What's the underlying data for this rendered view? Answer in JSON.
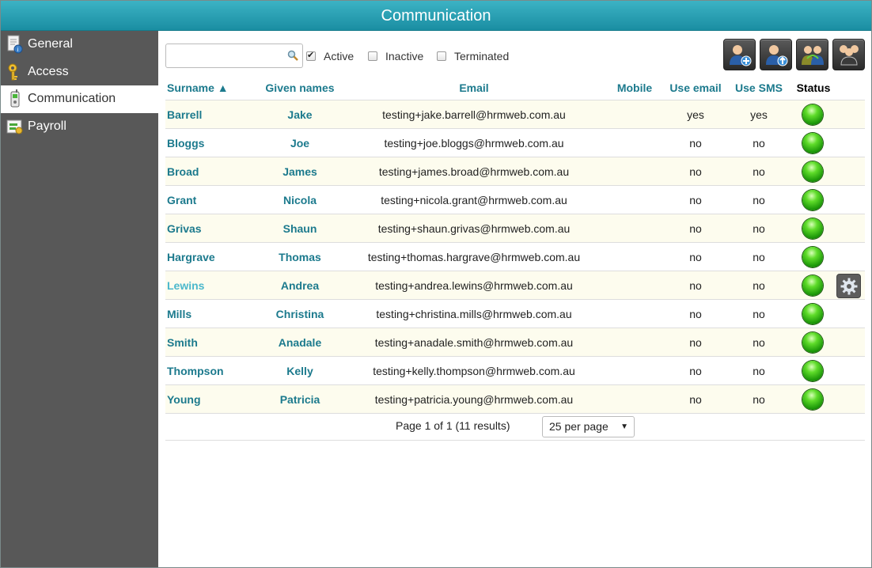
{
  "window": {
    "title": "Communication"
  },
  "sidebar": {
    "items": [
      {
        "label": "General",
        "active": false
      },
      {
        "label": "Access",
        "active": false
      },
      {
        "label": "Communication",
        "active": true
      },
      {
        "label": "Payroll",
        "active": false
      }
    ]
  },
  "search": {
    "value": "",
    "placeholder": ""
  },
  "filters": [
    {
      "label": "Active",
      "checked": true
    },
    {
      "label": "Inactive",
      "checked": false
    },
    {
      "label": "Terminated",
      "checked": false
    }
  ],
  "columns": {
    "surname": "Surname ▲",
    "given": "Given names",
    "email": "Email",
    "mobile": "Mobile",
    "use_email": "Use email",
    "use_sms": "Use SMS",
    "status": "Status"
  },
  "rows": [
    {
      "surname": "Barrell",
      "given": "Jake",
      "email": "testing+jake.barrell@hrmweb.com.au",
      "mobile": "",
      "use_email": "yes",
      "use_sms": "yes"
    },
    {
      "surname": "Bloggs",
      "given": "Joe",
      "email": "testing+joe.bloggs@hrmweb.com.au",
      "mobile": "",
      "use_email": "no",
      "use_sms": "no"
    },
    {
      "surname": "Broad",
      "given": "James",
      "email": "testing+james.broad@hrmweb.com.au",
      "mobile": "",
      "use_email": "no",
      "use_sms": "no"
    },
    {
      "surname": "Grant",
      "given": "Nicola",
      "email": "testing+nicola.grant@hrmweb.com.au",
      "mobile": "",
      "use_email": "no",
      "use_sms": "no"
    },
    {
      "surname": "Grivas",
      "given": "Shaun",
      "email": "testing+shaun.grivas@hrmweb.com.au",
      "mobile": "",
      "use_email": "no",
      "use_sms": "no"
    },
    {
      "surname": "Hargrave",
      "given": "Thomas",
      "email": "testing+thomas.hargrave@hrmweb.com.au",
      "mobile": "",
      "use_email": "no",
      "use_sms": "no"
    },
    {
      "surname": "Lewins",
      "given": "Andrea",
      "email": "testing+andrea.lewins@hrmweb.com.au",
      "mobile": "",
      "use_email": "no",
      "use_sms": "no"
    },
    {
      "surname": "Mills",
      "given": "Christina",
      "email": "testing+christina.mills@hrmweb.com.au",
      "mobile": "",
      "use_email": "no",
      "use_sms": "no"
    },
    {
      "surname": "Smith",
      "given": "Anadale",
      "email": "testing+anadale.smith@hrmweb.com.au",
      "mobile": "",
      "use_email": "no",
      "use_sms": "no"
    },
    {
      "surname": "Thompson",
      "given": "Kelly",
      "email": "testing+kelly.thompson@hrmweb.com.au",
      "mobile": "",
      "use_email": "no",
      "use_sms": "no"
    },
    {
      "surname": "Young",
      "given": "Patricia",
      "email": "testing+patricia.young@hrmweb.com.au",
      "mobile": "",
      "use_email": "no",
      "use_sms": "no"
    }
  ],
  "pager": {
    "text": "Page 1 of 1 (11 results)",
    "per_page": "25 per page"
  },
  "colors": {
    "accent": "#1c7a8d",
    "titlebar": "#2aa3b5",
    "sidebar": "#585858",
    "row_alt": "#fdfcee",
    "status_ok": "#3cc41a"
  },
  "toolbar": {
    "buttons": [
      {
        "icon": "add-user-icon"
      },
      {
        "icon": "upload-user-icon"
      },
      {
        "icon": "swap-users-icon"
      },
      {
        "icon": "group-users-icon"
      }
    ]
  }
}
